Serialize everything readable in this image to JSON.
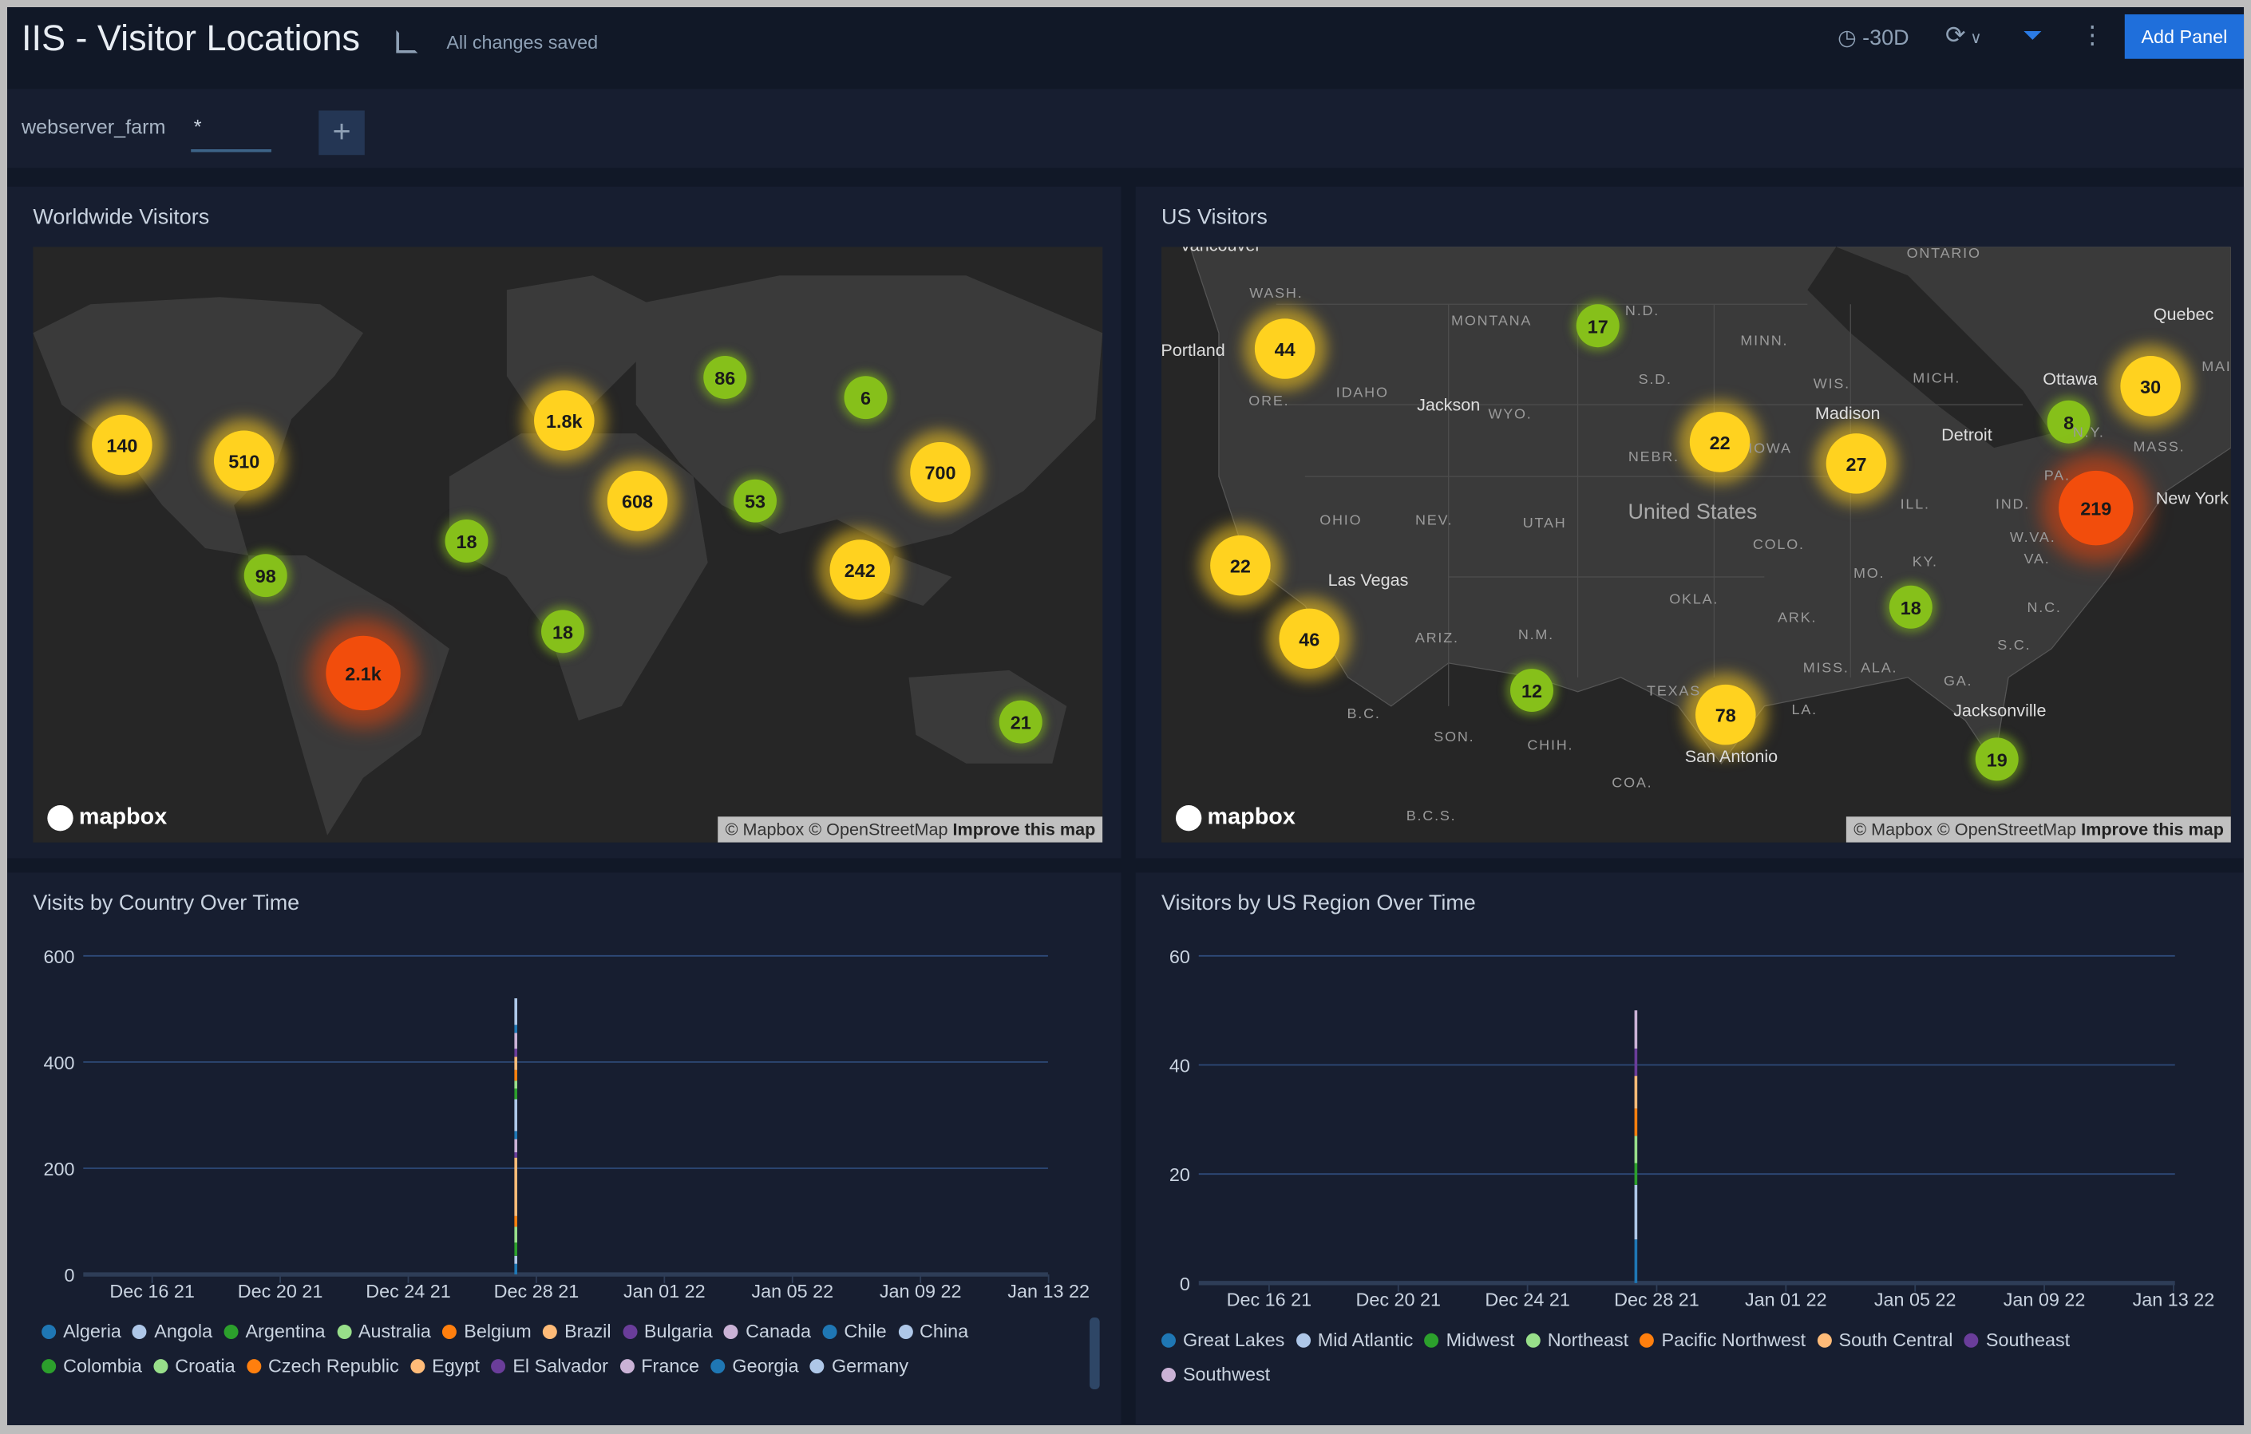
{
  "header": {
    "title": "IIS - Visitor Locations",
    "save_status": "All changes saved",
    "time_range": "-30D",
    "add_panel": "Add Panel"
  },
  "filters": [
    {
      "label": "webserver_farm",
      "value": "*"
    }
  ],
  "colors": {
    "accent": "#1f6fdb",
    "cluster_small": "#86c01a",
    "cluster_medium": "#ffd21f",
    "cluster_large": "#f24d0c"
  },
  "worldwide": {
    "title": "Worldwide Visitors",
    "clusters": [
      "140",
      "510",
      "98",
      "2.1k",
      "1.8k",
      "86",
      "6",
      "608",
      "18",
      "18",
      "53",
      "700",
      "242",
      "21"
    ],
    "attribution": "© Mapbox © OpenStreetMap",
    "improve": "Improve this map",
    "logo": "mapbox"
  },
  "us": {
    "title": "US Visitors",
    "clusters": [
      "44",
      "17",
      "22",
      "27",
      "8",
      "30",
      "219",
      "22",
      "46",
      "18",
      "12",
      "78",
      "19"
    ],
    "labels": [
      "WASH.",
      "MONTANA",
      "N.D.",
      "MINN.",
      "ONTARIO",
      "ORE.",
      "IDAHO",
      "WYO.",
      "S.D.",
      "WIS.",
      "MICH.",
      "NEBR.",
      "IOWA",
      "ILL.",
      "IND.",
      "OHIO",
      "NEV.",
      "UTAH",
      "COLO.",
      "MO.",
      "KY.",
      "W.VA.",
      "VA.",
      "PA.",
      "N.Y.",
      "MASS.",
      "MAI",
      "OKLA.",
      "ARK.",
      "ARIZ.",
      "N.M.",
      "TEXAS",
      "LA.",
      "MISS.",
      "ALA.",
      "GA.",
      "S.C.",
      "N.C.",
      "B.C.",
      "SON.",
      "CHIH.",
      "COA.",
      "B.C.S."
    ],
    "cities": [
      "Vancouver",
      "Portland",
      "Jackson",
      "Madison",
      "Detroit",
      "Ottawa",
      "Quebec",
      "New York",
      "Las Vegas",
      "San Antonio",
      "Jacksonville"
    ],
    "country_label": "United States",
    "attribution": "© Mapbox © OpenStreetMap",
    "improve": "Improve this map",
    "logo": "mapbox"
  },
  "chart_data": [
    {
      "type": "bar",
      "title": "Visits by Country Over Time",
      "stacked": true,
      "ylim": [
        0,
        600
      ],
      "yticks": [
        0,
        200,
        400,
        600
      ],
      "xticks": [
        "Dec 16 21",
        "Dec 20 21",
        "Dec 24 21",
        "Dec 28 21",
        "Jan 01 22",
        "Jan 05 22",
        "Jan 09 22",
        "Jan 13 22"
      ],
      "x": [
        "Dec 27 21"
      ],
      "series": [
        {
          "name": "Algeria",
          "color": "#1f77b4",
          "values": [
            20
          ]
        },
        {
          "name": "Angola",
          "color": "#aec7e8",
          "values": [
            15
          ]
        },
        {
          "name": "Argentina",
          "color": "#2ca02c",
          "values": [
            25
          ]
        },
        {
          "name": "Australia",
          "color": "#98df8a",
          "values": [
            30
          ]
        },
        {
          "name": "Belgium",
          "color": "#ff7f0e",
          "values": [
            20
          ]
        },
        {
          "name": "Brazil",
          "color": "#ffbb78",
          "values": [
            110
          ]
        },
        {
          "name": "Bulgaria",
          "color": "#6a3d9a",
          "values": [
            10
          ]
        },
        {
          "name": "Canada",
          "color": "#cab2d6",
          "values": [
            25
          ]
        },
        {
          "name": "Chile",
          "color": "#1f77b4",
          "values": [
            15
          ]
        },
        {
          "name": "China",
          "color": "#aec7e8",
          "values": [
            60
          ]
        },
        {
          "name": "Colombia",
          "color": "#2ca02c",
          "values": [
            20
          ]
        },
        {
          "name": "Croatia",
          "color": "#98df8a",
          "values": [
            15
          ]
        },
        {
          "name": "Czech Republic",
          "color": "#ff7f0e",
          "values": [
            20
          ]
        },
        {
          "name": "Egypt",
          "color": "#ffbb78",
          "values": [
            25
          ]
        },
        {
          "name": "El Salvador",
          "color": "#6a3d9a",
          "values": [
            15
          ]
        },
        {
          "name": "France",
          "color": "#cab2d6",
          "values": [
            30
          ]
        },
        {
          "name": "Georgia",
          "color": "#1f77b4",
          "values": [
            15
          ]
        },
        {
          "name": "Germany",
          "color": "#aec7e8",
          "values": [
            50
          ]
        }
      ]
    },
    {
      "type": "bar",
      "title": "Visitors by US Region Over Time",
      "stacked": true,
      "ylim": [
        0,
        60
      ],
      "yticks": [
        0,
        20,
        40,
        60
      ],
      "xticks": [
        "Dec 16 21",
        "Dec 20 21",
        "Dec 24 21",
        "Dec 28 21",
        "Jan 01 22",
        "Jan 05 22",
        "Jan 09 22",
        "Jan 13 22"
      ],
      "x": [
        "Dec 27 21"
      ],
      "series": [
        {
          "name": "Great Lakes",
          "color": "#1f77b4",
          "values": [
            8
          ]
        },
        {
          "name": "Mid Atlantic",
          "color": "#aec7e8",
          "values": [
            10
          ]
        },
        {
          "name": "Midwest",
          "color": "#2ca02c",
          "values": [
            4
          ]
        },
        {
          "name": "Northeast",
          "color": "#98df8a",
          "values": [
            5
          ]
        },
        {
          "name": "Pacific Northwest",
          "color": "#ff7f0e",
          "values": [
            5
          ]
        },
        {
          "name": "South Central",
          "color": "#ffbb78",
          "values": [
            6
          ]
        },
        {
          "name": "Southeast",
          "color": "#6a3d9a",
          "values": [
            5
          ]
        },
        {
          "name": "Southwest",
          "color": "#cab2d6",
          "values": [
            7
          ]
        }
      ]
    }
  ]
}
